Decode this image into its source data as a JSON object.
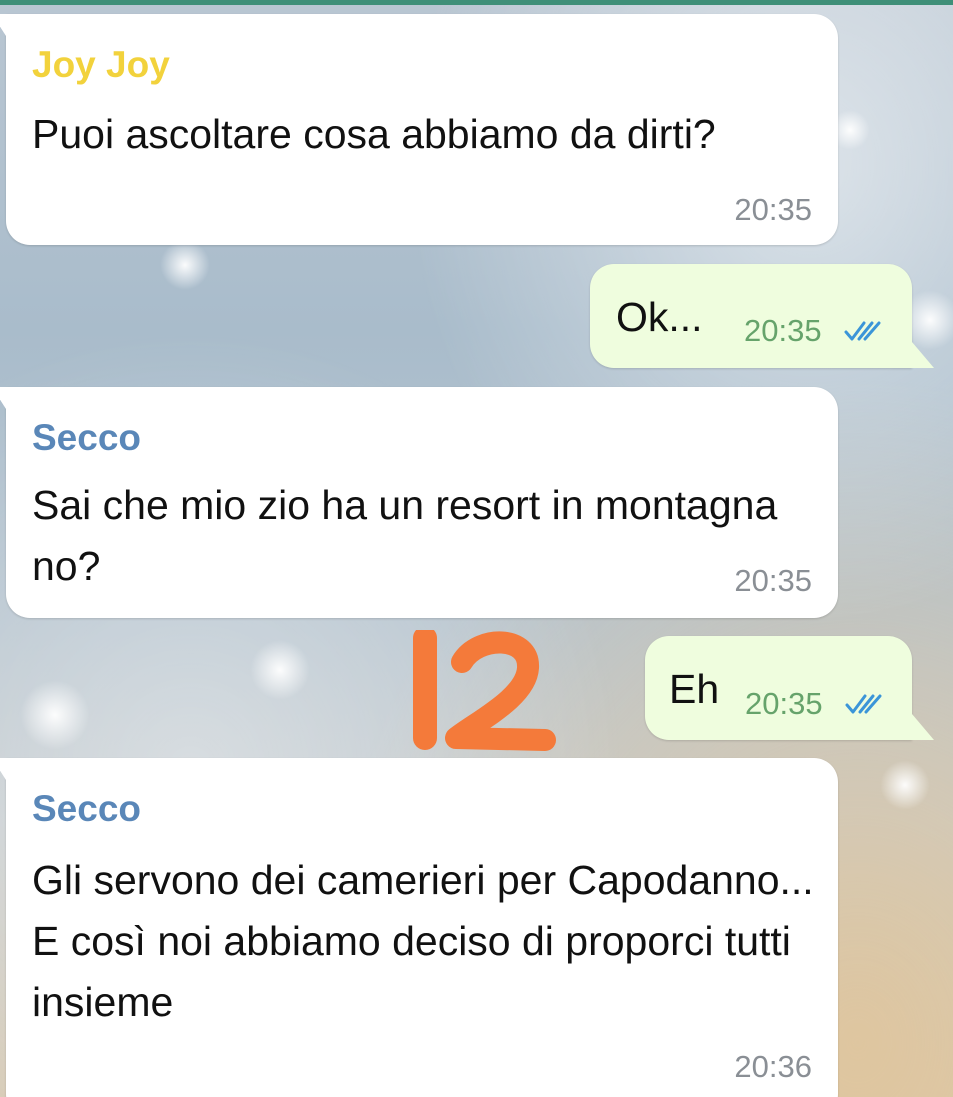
{
  "messages": [
    {
      "sender": "Joy Joy",
      "text": "Puoi ascoltare cosa abbiamo da dirti?",
      "time": "20:35",
      "sender_color": "#f2d23c"
    },
    {
      "text": "Ok...",
      "time": "20:35",
      "status": "double-check-icon"
    },
    {
      "sender": "Secco",
      "text": "Sai che mio zio ha un resort in montagna no?",
      "time": "20:35",
      "sender_color": "#5a87b8"
    },
    {
      "text": "Eh",
      "time": "20:35",
      "status": "double-check-icon"
    },
    {
      "sender": "Secco",
      "text": "Gli servono dei camerieri per Capodanno... E così noi abbiamo deciso di proporci tutti insieme",
      "time": "20:36",
      "sender_color": "#5a87b8"
    }
  ],
  "annotation": {
    "text": "12",
    "color": "#f47a3a"
  },
  "colors": {
    "incoming_bubble": "#ffffff",
    "outgoing_bubble": "#effdde",
    "header_strip": "#3f8f78",
    "tick_color": "#3b95d8"
  }
}
